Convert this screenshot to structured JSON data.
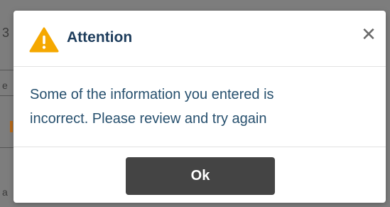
{
  "dialog": {
    "title": "Attention",
    "message_line1": "Some of the information you entered is",
    "message_line2": "incorrect. Please review and try again",
    "close_glyph": "✕",
    "ok_label": "Ok",
    "icons": {
      "title_icon": "warning-icon",
      "close_icon": "close-icon"
    }
  },
  "background": {
    "fragments": [
      "3",
      "e",
      "a"
    ]
  },
  "colors": {
    "backdrop": "#7d7d7d",
    "warning": "#f5a800",
    "title": "#1e3d5c",
    "message": "#27506e",
    "button": "#444444"
  }
}
